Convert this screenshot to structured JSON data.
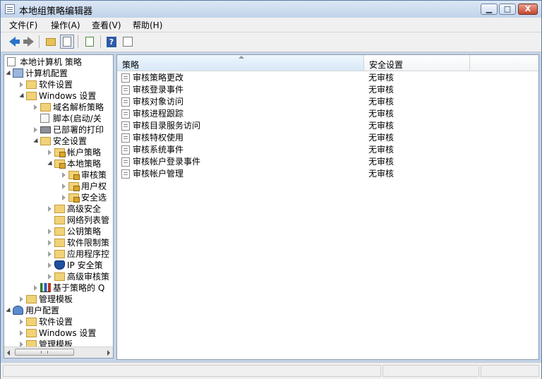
{
  "window": {
    "title": "本地组策略编辑器",
    "buttons": {
      "minimize": "▁",
      "maximize": "□",
      "close": "X"
    }
  },
  "menu": [
    "文件(F)",
    "操作(A)",
    "查看(V)",
    "帮助(H)"
  ],
  "toolbar": {
    "icons": [
      "back-arrow-icon",
      "forward-arrow-icon",
      "up-folder-icon",
      "show-hide-tree-icon",
      "export-list-icon",
      "help-icon",
      "show-action-pane-icon"
    ]
  },
  "tree": {
    "items": [
      {
        "label": "本地计算机 策略",
        "icon": "doc",
        "toggle": "none"
      },
      {
        "label": "计算机配置",
        "icon": "computer",
        "toggle": "open"
      },
      {
        "label": "软件设置",
        "icon": "folder",
        "toggle": "closed"
      },
      {
        "label": "Windows 设置",
        "icon": "folder",
        "toggle": "open"
      },
      {
        "label": "域名解析策略",
        "icon": "folder",
        "toggle": "closed"
      },
      {
        "label": "脚本(启动/关",
        "icon": "script",
        "toggle": "none"
      },
      {
        "label": "已部署的打印",
        "icon": "printer",
        "toggle": "closed"
      },
      {
        "label": "安全设置",
        "icon": "folder",
        "toggle": "open"
      },
      {
        "label": "帐户策略",
        "icon": "lockf",
        "toggle": "closed"
      },
      {
        "label": "本地策略",
        "icon": "lockf",
        "toggle": "open"
      },
      {
        "label": "审核策",
        "icon": "lockf",
        "toggle": "closed"
      },
      {
        "label": "用户权",
        "icon": "lockf",
        "toggle": "closed"
      },
      {
        "label": "安全选",
        "icon": "lockf",
        "toggle": "closed"
      },
      {
        "label": "高级安全",
        "icon": "folder",
        "toggle": "closed"
      },
      {
        "label": "网络列表管",
        "icon": "folder",
        "toggle": "none"
      },
      {
        "label": "公钥策略",
        "icon": "folder",
        "toggle": "closed"
      },
      {
        "label": "软件限制策",
        "icon": "folder",
        "toggle": "closed"
      },
      {
        "label": "应用程序控",
        "icon": "folder",
        "toggle": "closed"
      },
      {
        "label": "IP 安全策",
        "icon": "shield",
        "toggle": "closed"
      },
      {
        "label": "高级审核策",
        "icon": "folder",
        "toggle": "closed"
      },
      {
        "label": "基于策略的 Q",
        "icon": "chart",
        "toggle": "closed"
      },
      {
        "label": "管理模板",
        "icon": "folder",
        "toggle": "closed"
      },
      {
        "label": "用户配置",
        "icon": "user",
        "toggle": "open"
      },
      {
        "label": "软件设置",
        "icon": "folder",
        "toggle": "closed"
      },
      {
        "label": "Windows 设置",
        "icon": "folder",
        "toggle": "closed"
      },
      {
        "label": "管理模板",
        "icon": "folder",
        "toggle": "closed"
      }
    ]
  },
  "list": {
    "columns": [
      "策略",
      "安全设置"
    ],
    "rows": [
      {
        "policy": "审核策略更改",
        "setting": "无审核"
      },
      {
        "policy": "审核登录事件",
        "setting": "无审核"
      },
      {
        "policy": "审核对象访问",
        "setting": "无审核"
      },
      {
        "policy": "审核进程跟踪",
        "setting": "无审核"
      },
      {
        "policy": "审核目录服务访问",
        "setting": "无审核"
      },
      {
        "policy": "审核特权使用",
        "setting": "无审核"
      },
      {
        "policy": "审核系统事件",
        "setting": "无审核"
      },
      {
        "policy": "审核帐户登录事件",
        "setting": "无审核"
      },
      {
        "policy": "审核帐户管理",
        "setting": "无审核"
      }
    ]
  },
  "scrollbar": {
    "grip": "|||"
  }
}
